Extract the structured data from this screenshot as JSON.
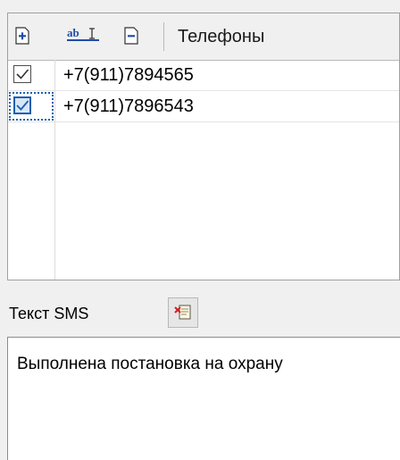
{
  "phones": {
    "header": "Телефоны",
    "toolbar": {
      "add_icon": "add-icon",
      "rename_icon": "rename-icon",
      "remove_icon": "remove-icon"
    },
    "rows": [
      {
        "number": "+7(911)7894565",
        "checked": true,
        "selected": false
      },
      {
        "number": "+7(911)7896543",
        "checked": true,
        "selected": true
      }
    ]
  },
  "sms": {
    "label": "Текст SMS",
    "template_button_icon": "insert-template-icon",
    "text": "Выполнена постановка на охрану"
  },
  "colors": {
    "panel_bg": "#f0f0f0",
    "list_bg": "#ffffff",
    "selection": "#1c5fb0",
    "icon_blue": "#1f4fa8"
  }
}
